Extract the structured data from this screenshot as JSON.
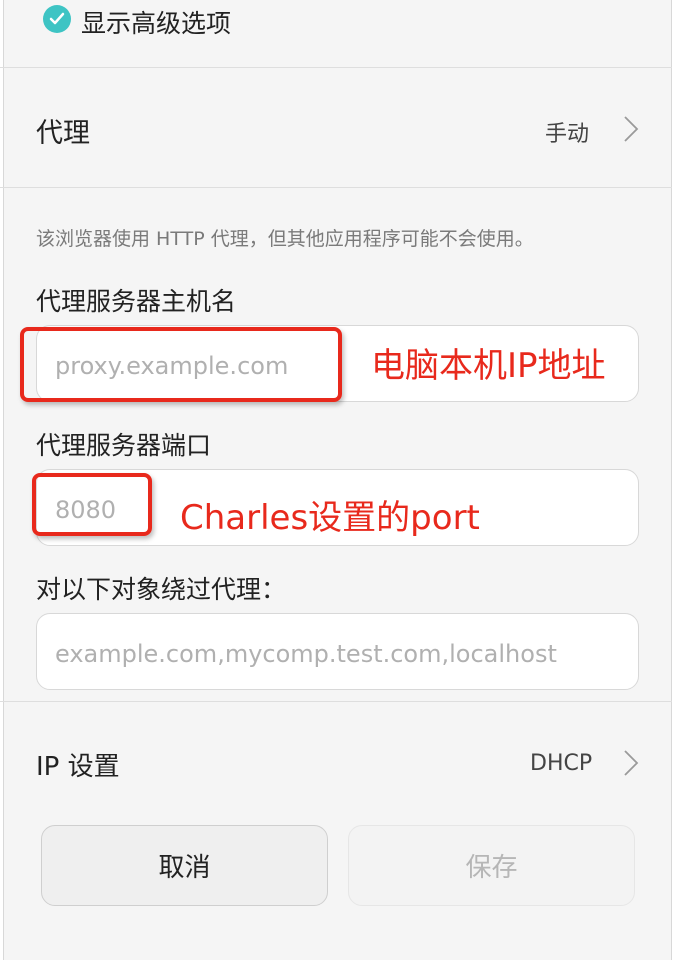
{
  "advanced": {
    "label": "显示高级选项",
    "checked": true
  },
  "proxy_row": {
    "label": "代理",
    "value": "手动"
  },
  "proxy_note": "该浏览器使用 HTTP 代理，但其他应用程序可能不会使用。",
  "hostname": {
    "label": "代理服务器主机名",
    "placeholder": "proxy.example.com",
    "annotation": "电脑本机IP地址"
  },
  "port": {
    "label": "代理服务器端口",
    "placeholder": "8080",
    "annotation": "Charles设置的port"
  },
  "bypass": {
    "label": "对以下对象绕过代理：",
    "placeholder": "example.com,mycomp.test.com,localhost"
  },
  "ip_row": {
    "label": "IP 设置",
    "value": "DHCP"
  },
  "buttons": {
    "cancel": "取消",
    "save": "保存"
  },
  "colors": {
    "accent": "#3ec4c4",
    "annotation": "#e8291c"
  }
}
